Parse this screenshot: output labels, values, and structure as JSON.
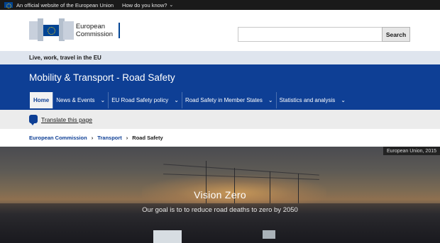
{
  "topbar": {
    "official_text": "An official website of the European Union",
    "how_do_you_know": "How do you know?"
  },
  "header": {
    "logo_line1": "European",
    "logo_line2": "Commission",
    "search_placeholder": "",
    "search_button": "Search"
  },
  "tagline": "Live, work, travel in the EU",
  "site": {
    "title": "Mobility & Transport - Road Safety",
    "nav": [
      {
        "label": "Home",
        "active": true,
        "dropdown": false
      },
      {
        "label": "News & Events",
        "active": false,
        "dropdown": true
      },
      {
        "label": "EU Road Safety policy",
        "active": false,
        "dropdown": true
      },
      {
        "label": "Road Safety in Member States",
        "active": false,
        "dropdown": true
      },
      {
        "label": "Statistics and analysis",
        "active": false,
        "dropdown": true
      }
    ]
  },
  "translate": {
    "label": "Translate this page"
  },
  "breadcrumb": [
    "European Commission",
    "Transport",
    "Road Safety"
  ],
  "hero": {
    "credit": "European Union, 2015",
    "title": "Vision Zero",
    "subtitle": "Our goal is to to reduce road deaths to zero by 2050"
  },
  "colors": {
    "brand_blue": "#0e3f95",
    "eu_yellow": "#ffd617",
    "topbar": "#1a1a1a",
    "tagline_bg": "#dfe5ee"
  }
}
